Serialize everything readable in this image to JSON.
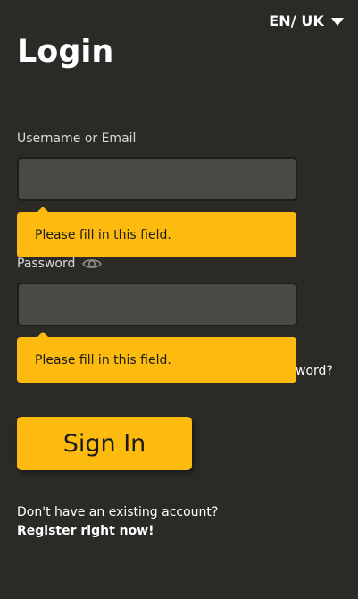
{
  "language": {
    "label": "EN/ UK"
  },
  "page": {
    "title": "Login"
  },
  "form": {
    "username_label": "Username or Email",
    "username_value": "",
    "password_label": "Password",
    "password_value": "",
    "validation_message": "Please fill in this field.",
    "forgot_password_partial": "word?",
    "sign_in_label": "Sign In"
  },
  "footer": {
    "question": "Don't have an existing account?",
    "register_link": "Register right now!"
  },
  "colors": {
    "background": "#2b2a27",
    "accent": "#fdbb0f",
    "field_background": "#4a4943"
  },
  "icons": {
    "language_caret": "chevron-down-icon",
    "password_toggle": "eye-icon"
  }
}
